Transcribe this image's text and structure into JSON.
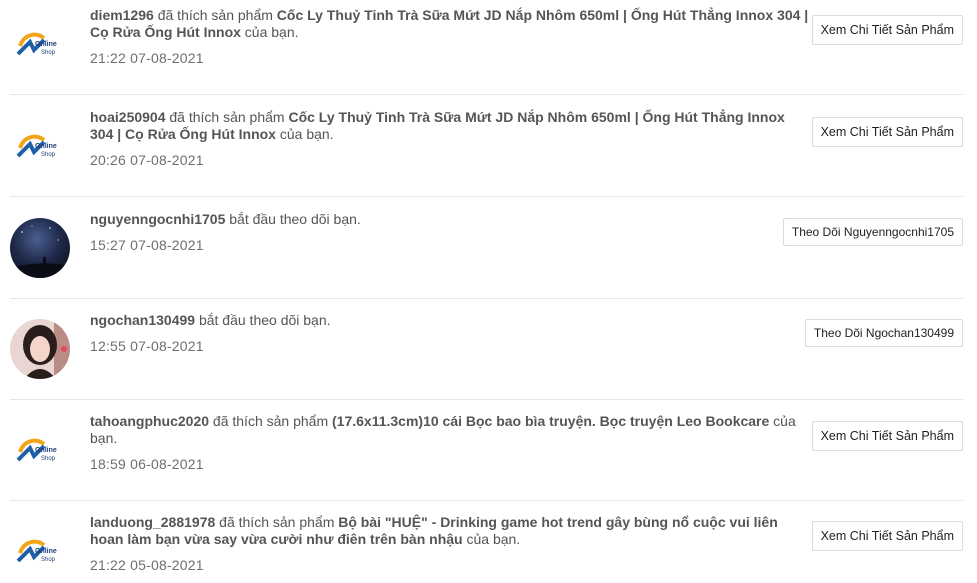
{
  "logo": {
    "line1": "Online",
    "line2": "Shop"
  },
  "notifications": [
    {
      "type": "like",
      "user": "diem1296",
      "action": "đã thích sản phẩm",
      "product": "Cốc Ly Thuỷ Tinh Trà Sữa Mứt JD Nắp Nhôm 650ml | Ống Hút Thẳng Innox 304 | Cọ Rửa Ống Hút Innox",
      "suffix": "của bạn.",
      "time": "21:22 07-08-2021",
      "button": "Xem Chi Tiết Sản Phẩm"
    },
    {
      "type": "like",
      "user": "hoai250904",
      "action": "đã thích sản phẩm",
      "product": "Cốc Ly Thuỷ Tinh Trà Sữa Mứt JD Nắp Nhôm 650ml | Ống Hút Thẳng Innox 304 | Cọ Rửa Ống Hút Innox",
      "suffix": "của bạn.",
      "time": "20:26 07-08-2021",
      "button": "Xem Chi Tiết Sản Phẩm"
    },
    {
      "type": "follow",
      "user": "nguyenngocnhi1705",
      "action": "bắt đầu theo dõi bạn.",
      "time": "15:27 07-08-2021",
      "button": "Theo Dõi Nguyenngocnhi1705"
    },
    {
      "type": "follow",
      "user": "ngochan130499",
      "action": "bắt đầu theo dõi bạn.",
      "time": "12:55 07-08-2021",
      "button": "Theo Dõi Ngochan130499"
    },
    {
      "type": "like",
      "user": "tahoangphuc2020",
      "action": "đã thích sản phẩm",
      "product": "(17.6x11.3cm)10 cái Bọc bao bìa truyện. Bọc truyện Leo Bookcare",
      "suffix": "của bạn.",
      "time": "18:59 06-08-2021",
      "button": "Xem Chi Tiết Sản Phẩm"
    },
    {
      "type": "like",
      "user": "landuong_2881978",
      "action": "đã thích sản phẩm",
      "product": "Bộ bài \"HUỆ\" - Drinking game hot trend gây bùng nổ cuộc vui liên hoan làm bạn vừa say vừa cười như điên trên bàn nhậu",
      "suffix": "của bạn.",
      "time": "21:22 05-08-2021",
      "button": "Xem Chi Tiết Sản Phẩm"
    }
  ]
}
